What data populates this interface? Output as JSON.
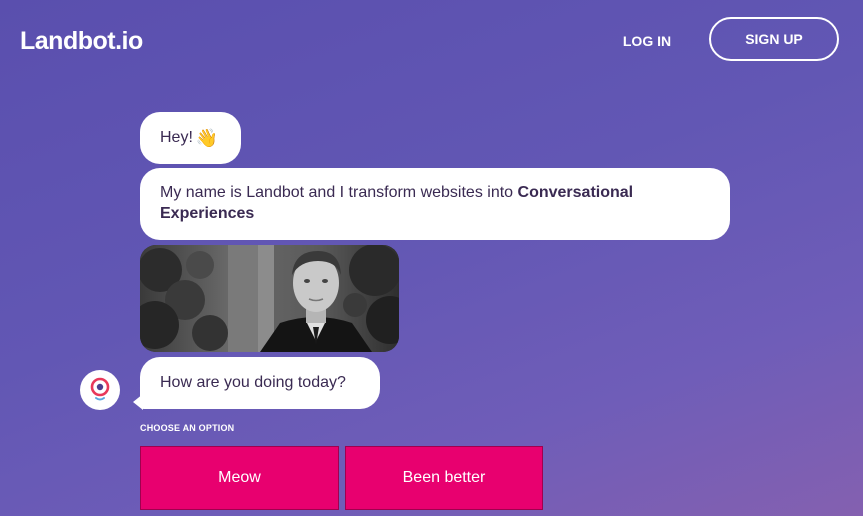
{
  "header": {
    "logo": "Landbot.io",
    "login_label": "LOG IN",
    "signup_label": "SIGN UP"
  },
  "chat": {
    "messages": [
      {
        "text": "Hey!",
        "emoji": "👋"
      },
      {
        "text": "My name is Landbot and I transform websites into ",
        "bold": "Conversational Experiences"
      },
      {
        "type": "image"
      },
      {
        "text": "How are you doing today?"
      }
    ],
    "choose_label": "CHOOSE AN OPTION",
    "options": [
      "Meow",
      "Been better"
    ]
  },
  "colors": {
    "accent": "#e8006f",
    "background": "#6257b4",
    "bubble": "#ffffff",
    "text": "#3a2a52"
  },
  "icons": [
    "waving-hand-icon",
    "landbot-avatar-icon"
  ]
}
